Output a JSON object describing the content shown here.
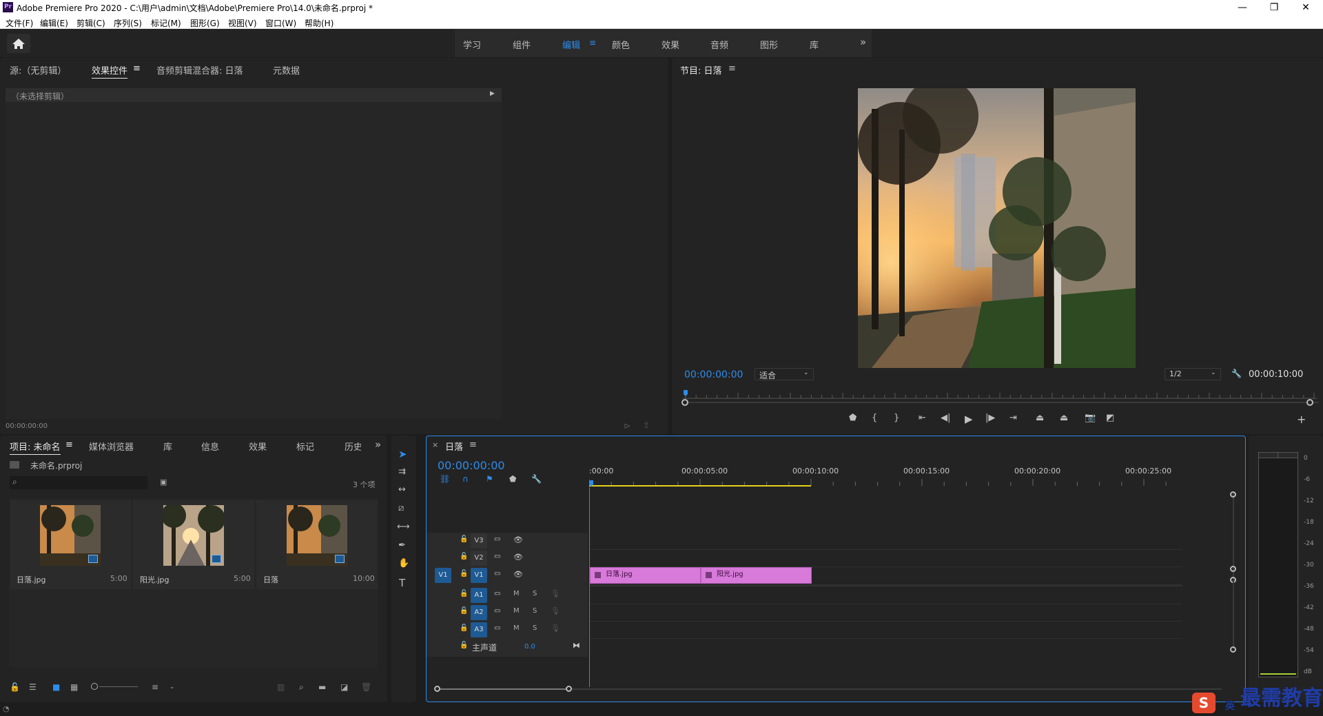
{
  "window": {
    "app_icon": "Pr",
    "title": "Adobe Premiere Pro 2020 - C:\\用户\\admin\\文档\\Adobe\\Premiere Pro\\14.0\\未命名.prproj *",
    "minimize": "—",
    "restore": "❐",
    "close": "✕"
  },
  "menu": [
    "文件(F)",
    "编辑(E)",
    "剪辑(C)",
    "序列(S)",
    "标记(M)",
    "图形(G)",
    "视图(V)",
    "窗口(W)",
    "帮助(H)"
  ],
  "workspaces": {
    "tabs": [
      "学习",
      "组件",
      "编辑",
      "颜色",
      "效果",
      "音频",
      "图形",
      "库"
    ],
    "active": "编辑",
    "overflow": "»"
  },
  "source_panel": {
    "tabs": [
      "源:（无剪辑）",
      "效果控件",
      "音频剪辑混合器: 日落",
      "元数据"
    ],
    "active_tab": "效果控件",
    "no_clip": "（未选择剪辑）",
    "timecode": "00:00:00:00"
  },
  "program_panel": {
    "title": "节目: 日落",
    "timecode": "00:00:00:00",
    "fit": "适合",
    "resolution": "1/2",
    "duration": "00:00:10:00"
  },
  "project_panel": {
    "tabs": [
      "项目: 未命名",
      "媒体浏览器",
      "库",
      "信息",
      "效果",
      "标记",
      "历史"
    ],
    "active_tab": "项目: 未命名",
    "project_file": "未命名.prproj",
    "item_count": "3 个项",
    "items": [
      {
        "name": "日落.jpg",
        "duration": "5:00"
      },
      {
        "name": "阳光.jpg",
        "duration": "5:00"
      },
      {
        "name": "日落",
        "duration": "10:00"
      }
    ]
  },
  "timeline": {
    "sequence": "日落",
    "close": "×",
    "timecode": "00:00:00:00",
    "ruler": [
      ":00:00",
      "00:00:05:00",
      "00:00:10:00",
      "00:00:15:00",
      "00:00:20:00",
      "00:00:25:00"
    ],
    "video_tracks": [
      "V3",
      "V2",
      "V1"
    ],
    "audio_tracks": [
      "A1",
      "A2",
      "A3"
    ],
    "source_patch": "V1",
    "mute": "M",
    "solo": "S",
    "master_label": "主声道",
    "master_value": "0.0",
    "clips": [
      {
        "name": "日落.jpg",
        "start": 0,
        "end": 5
      },
      {
        "name": "阳光.jpg",
        "start": 5,
        "end": 10
      }
    ]
  },
  "audio_meter": {
    "scale": [
      "0",
      "-6",
      "-12",
      "-18",
      "-24",
      "-30",
      "-36",
      "-42",
      "-48",
      "-54",
      "dB"
    ]
  },
  "watermark": {
    "text": "最需教育",
    "ime": "英"
  },
  "colors": {
    "accent": "#2d8ceb",
    "clip": "#d77ad9",
    "panel": "#232323",
    "playhead": "#2d8ceb",
    "work_area": "#e6d21a"
  }
}
